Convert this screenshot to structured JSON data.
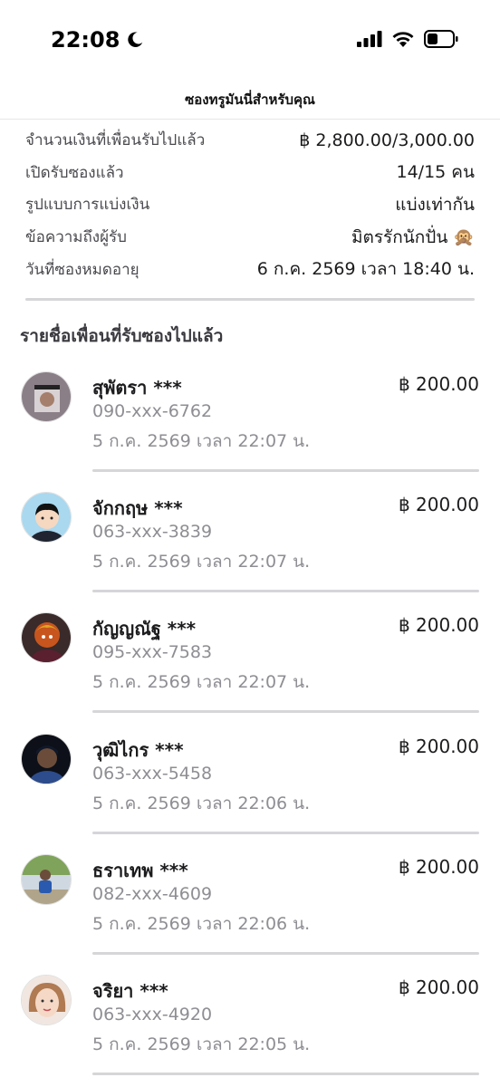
{
  "status_bar": {
    "time": "22:08"
  },
  "header": {
    "title": "ซองทรูมันนี่สำหรับคุณ"
  },
  "summary": [
    {
      "label": "จำนวนเงินที่เพื่อนรับไปแล้ว",
      "value": "฿ 2,800.00/3,000.00"
    },
    {
      "label": "เปิดรับซองแล้ว",
      "value": "14/15 คน"
    },
    {
      "label": "รูปแบบการแบ่งเงิน",
      "value": "แบ่งเท่ากัน"
    },
    {
      "label": "ข้อความถึงผู้รับ",
      "value": "มิตรรักนักปั่น 🙊"
    },
    {
      "label": "วันที่ซองหมดอายุ",
      "value": "6 ก.ค. 2569 เวลา 18:40 น."
    }
  ],
  "section_title": "รายชื่อเพื่อนที่รับซองไปแล้ว",
  "recipients": [
    {
      "name": "สุพัตรา ***",
      "amount": "฿ 200.00",
      "phone": "090-xxx-6762",
      "date": "5 ก.ค. 2569 เวลา 22:07 น."
    },
    {
      "name": "จักกฤษ ***",
      "amount": "฿ 200.00",
      "phone": "063-xxx-3839",
      "date": "5 ก.ค. 2569 เวลา 22:07 น."
    },
    {
      "name": "กัญญณัฐ ***",
      "amount": "฿ 200.00",
      "phone": "095-xxx-7583",
      "date": "5 ก.ค. 2569 เวลา 22:07 น."
    },
    {
      "name": "วุฒิไกร ***",
      "amount": "฿ 200.00",
      "phone": "063-xxx-5458",
      "date": "5 ก.ค. 2569 เวลา 22:06 น."
    },
    {
      "name": "ธราเทพ ***",
      "amount": "฿ 200.00",
      "phone": "082-xxx-4609",
      "date": "5 ก.ค. 2569 เวลา 22:06 น."
    },
    {
      "name": "จริยา ***",
      "amount": "฿ 200.00",
      "phone": "063-xxx-4920",
      "date": "5 ก.ค. 2569 เวลา 22:05 น."
    }
  ],
  "colors": {
    "text": "#1c1c1e",
    "secondary": "#8e8e93",
    "divider": "#d6d6d9"
  }
}
